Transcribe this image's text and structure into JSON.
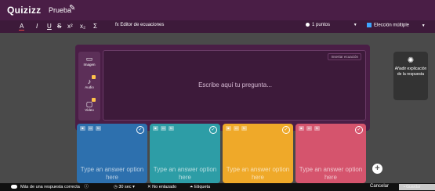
{
  "header": {
    "logo": "Quizizz",
    "quiz_title": "Prueba",
    "edit_icon": "pencil-icon"
  },
  "toolbar": {
    "text_color": "A",
    "italic": "I",
    "underline": "U",
    "strikethrough": "S",
    "superscript": "x²",
    "subscript": "x₂",
    "symbol": "Σ",
    "equation_label": "Editor de ecuaciones",
    "points_label": "1 puntos",
    "type_label": "Elección múltiple"
  },
  "question": {
    "placeholder": "Escribe aquí tu pregunta...",
    "insert_eq": "Insertar ecuación",
    "media": [
      {
        "icon": "image-icon",
        "label": "Imagen"
      },
      {
        "icon": "audio-icon",
        "label": "Audio"
      },
      {
        "icon": "video-icon",
        "label": "Video"
      }
    ]
  },
  "answers": [
    {
      "placeholder": "Type an answer option here",
      "color": "#2d70ae"
    },
    {
      "placeholder": "Type an answer option here",
      "color": "#2d9da6"
    },
    {
      "placeholder": "Type an answer option here",
      "color": "#efa929"
    },
    {
      "placeholder": "Type an answer option here",
      "color": "#d5546d"
    }
  ],
  "side_panel": {
    "icon": "bulb-icon",
    "text": "Añadir explicación de la respuesta"
  },
  "bottom": {
    "multi_correct": "Más de una respuesta correcta",
    "time": "30 sec",
    "unlinked": "No enlazado",
    "tag": "Etiqueta",
    "cancel": "Cancelar",
    "save": "Guardar"
  },
  "colors": {
    "header": "#4a1e46",
    "toolbar": "#3d1a3a",
    "canvas": "#4a4a4a"
  }
}
